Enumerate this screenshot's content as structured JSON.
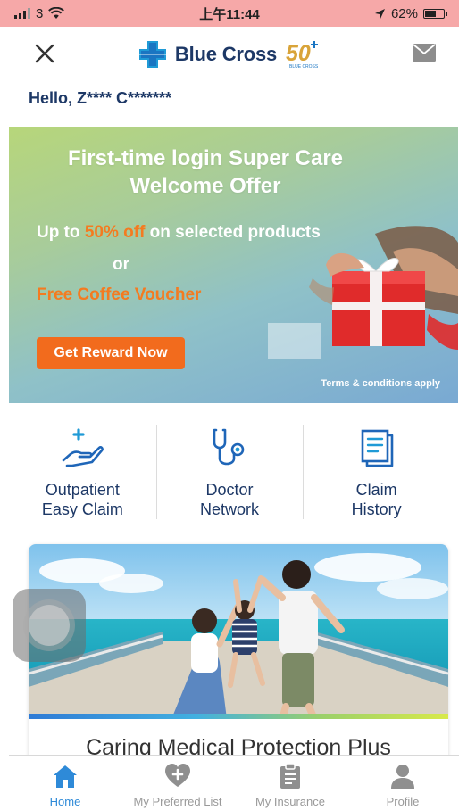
{
  "status_bar": {
    "carrier": "3",
    "time": "上午11:44",
    "battery": "62%",
    "battery_level": 0.62
  },
  "header": {
    "brand_name": "Blue Cross",
    "anniversary_badge": "50",
    "anniversary_sub": "BLUE CROSS"
  },
  "greeting": "Hello, Z**** C*******",
  "banner": {
    "title_line1": "First-time login Super Care",
    "title_line2": "Welcome Offer",
    "offer_prefix": "Up to ",
    "offer_highlight": "50% off",
    "offer_suffix": " on selected products",
    "or_text": "or",
    "coffee_text": "Free Coffee Voucher",
    "button_label": "Get Reward Now",
    "terms": "Terms & conditions apply"
  },
  "quick_actions": [
    {
      "line1": "Outpatient",
      "line2": "Easy Claim",
      "icon": "hand-plus-icon"
    },
    {
      "line1": "Doctor",
      "line2": "Network",
      "icon": "stethoscope-icon"
    },
    {
      "line1": "Claim",
      "line2": "History",
      "icon": "document-icon"
    }
  ],
  "promo": {
    "title": "Caring Medical Protection Plus"
  },
  "bottom_nav": [
    {
      "label": "Home",
      "icon": "home-icon",
      "active": true
    },
    {
      "label": "My Preferred List",
      "icon": "heart-plus-icon",
      "active": false
    },
    {
      "label": "My Insurance",
      "icon": "clipboard-icon",
      "active": false
    },
    {
      "label": "Profile",
      "icon": "profile-icon",
      "active": false
    }
  ],
  "colors": {
    "brand_blue": "#1d3866",
    "accent_orange": "#f26b1d",
    "active_nav": "#2e8ad8",
    "icon_blue": "#1f66b8"
  }
}
